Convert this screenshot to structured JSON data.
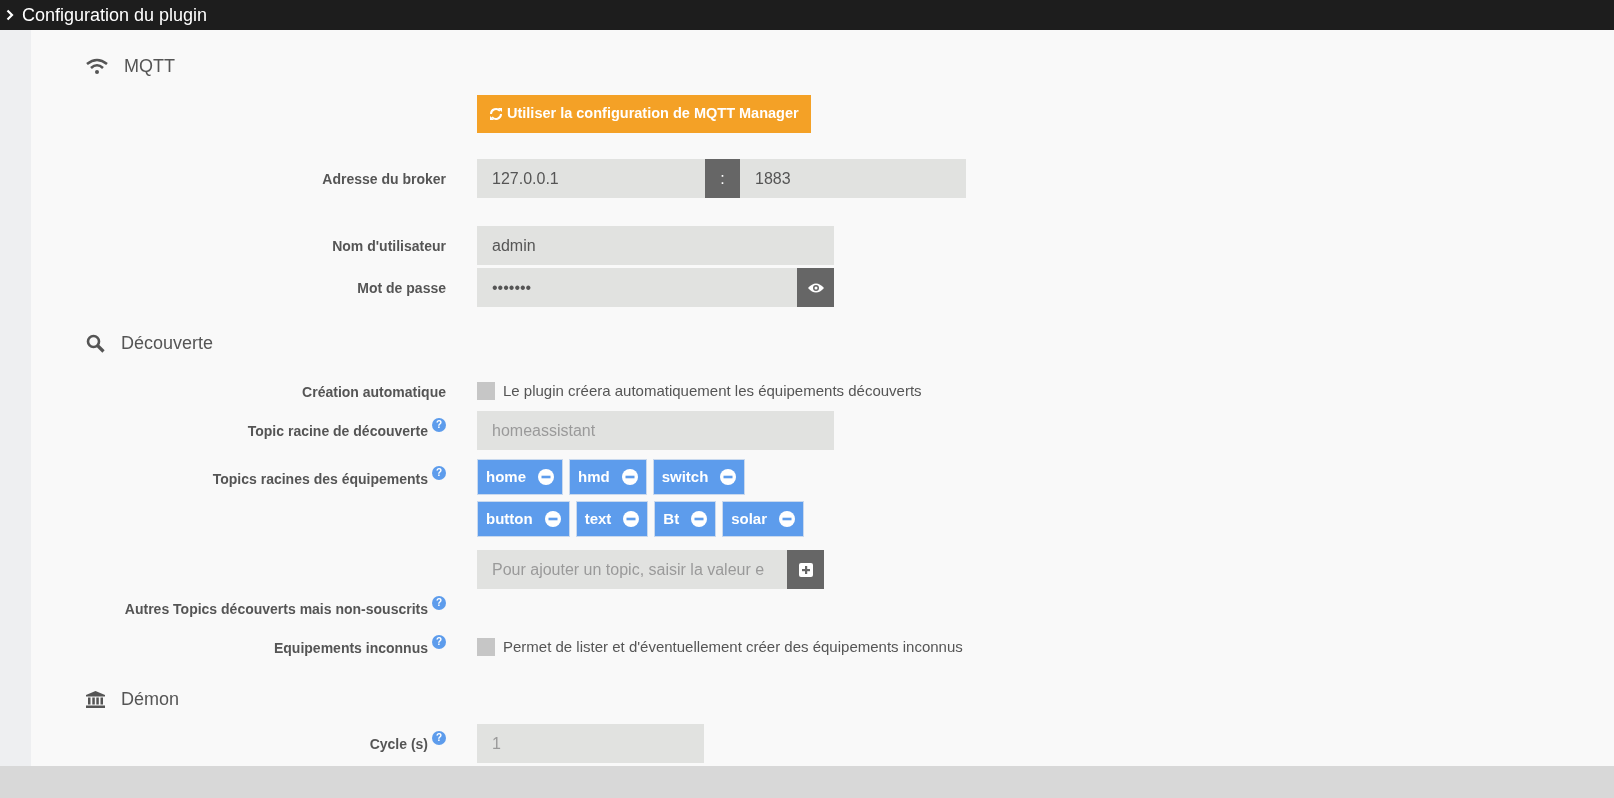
{
  "header": {
    "title": "Configuration du plugin"
  },
  "sections": [
    {
      "title": "MQTT",
      "rows": [
        {
          "kind": "button",
          "label": "",
          "text": "Utiliser la configuration de MQTT Manager"
        },
        {
          "kind": "address",
          "label": "Adresse du broker",
          "host": "127.0.0.1",
          "separator": ":",
          "port": "1883"
        },
        {
          "kind": "text",
          "label": "Nom d'utilisateur",
          "value": "admin"
        },
        {
          "kind": "password",
          "label": "Mot de passe",
          "value": "•••••••"
        }
      ]
    },
    {
      "title": "Découverte",
      "rows": [
        {
          "kind": "checkbox",
          "label": "Création automatique",
          "checked": false,
          "text": "Le plugin créera automatiquement les équipements découverts"
        },
        {
          "kind": "text",
          "label": "Topic racine de découverte",
          "help": "?",
          "placeholder": "homeassistant"
        },
        {
          "kind": "tags",
          "label": "Topics racines des équipements",
          "help": "?",
          "tags": [
            "home",
            "hmd",
            "switch",
            "button",
            "text",
            "Bt",
            "solar"
          ],
          "placeholder": "Pour ajouter un topic, saisir la valeur e"
        },
        {
          "kind": "none",
          "label": "Autres Topics découverts mais non-souscrits",
          "help": "?"
        },
        {
          "kind": "checkbox",
          "label": "Equipements inconnus",
          "help": "?",
          "checked": false,
          "text": "Permet de lister et d'éventuellement créer des équipements inconnus"
        }
      ]
    },
    {
      "title": "Démon",
      "rows": [
        {
          "kind": "short",
          "label": "Cycle (s)",
          "help": "?",
          "placeholder": "1"
        }
      ]
    }
  ]
}
